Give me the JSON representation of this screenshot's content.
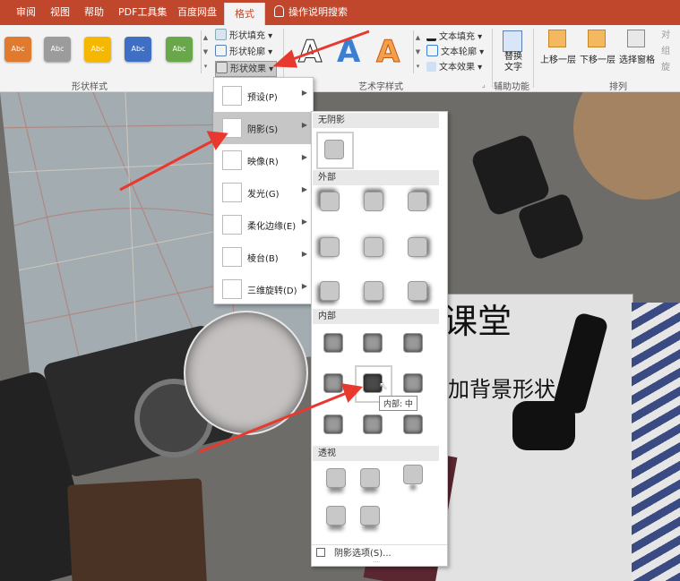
{
  "tabs": [
    "审阅",
    "视图",
    "帮助",
    "PDF工具集",
    "百度网盘",
    "格式",
    "操作说明搜索"
  ],
  "ribbon": {
    "style_swatch_label": "Abc",
    "swatch_colors": [
      "#e07a2e",
      "#9c9c9c",
      "#f5b700",
      "#3f6fc4",
      "#69a84a"
    ],
    "shape_fill": "形状填充",
    "shape_outline": "形状轮廓",
    "shape_effects": "形状效果",
    "group_shape_styles": "形状样式",
    "wordart_letter": "A",
    "text_fill": "文本填充",
    "text_outline": "文本轮廓",
    "text_effects": "文本效果",
    "group_wordart": "艺术字样式",
    "alt_text": "替换文字",
    "group_accessibility": "辅助功能",
    "bring_forward": "上移一层",
    "send_backward": "下移一层",
    "selection_pane": "选择窗格",
    "group_arrange": "排列",
    "align_partial": "对",
    "group_partial": "组",
    "rotate_partial": "旋"
  },
  "effects_menu": [
    {
      "label": "预设(P)"
    },
    {
      "label": "阴影(S)"
    },
    {
      "label": "映像(R)"
    },
    {
      "label": "发光(G)"
    },
    {
      "label": "柔化边缘(E)"
    },
    {
      "label": "棱台(B)"
    },
    {
      "label": "三维旋转(D)"
    }
  ],
  "shadow_gallery": {
    "none": "无阴影",
    "outer": "外部",
    "inner": "内部",
    "perspective": "透视",
    "tooltip": "内部: 中",
    "options": "阴影选项(S)..."
  },
  "slide": {
    "title_text": "课堂",
    "subtitle_text": "加背景形状"
  },
  "colors": {
    "ribbon_accent": "#c0472b",
    "arrow": "#e8392f"
  }
}
